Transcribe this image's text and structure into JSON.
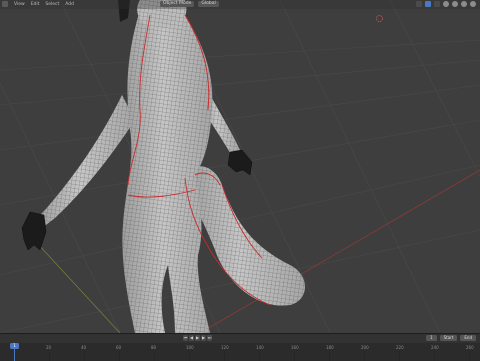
{
  "header": {
    "menus": [
      "View",
      "Edit",
      "Select",
      "Add"
    ],
    "mode_label": "Object Mode",
    "orientation_label": "Global"
  },
  "timeline": {
    "ruler_labels": [
      "0",
      "20",
      "40",
      "60",
      "80",
      "100",
      "120",
      "140",
      "160",
      "180",
      "200",
      "220",
      "240",
      "260"
    ],
    "current_frame": "1",
    "start_label": "Start",
    "end_label": "End",
    "controls": [
      "⏮",
      "◀",
      "▶",
      "▶",
      "⏭"
    ]
  },
  "colors": {
    "viewport_bg": "#3e3e3e",
    "grid": "#4a4a4a",
    "seam": "#cc2a2a",
    "mesh": "#b9b9b9",
    "accent": "#4a78c2"
  }
}
